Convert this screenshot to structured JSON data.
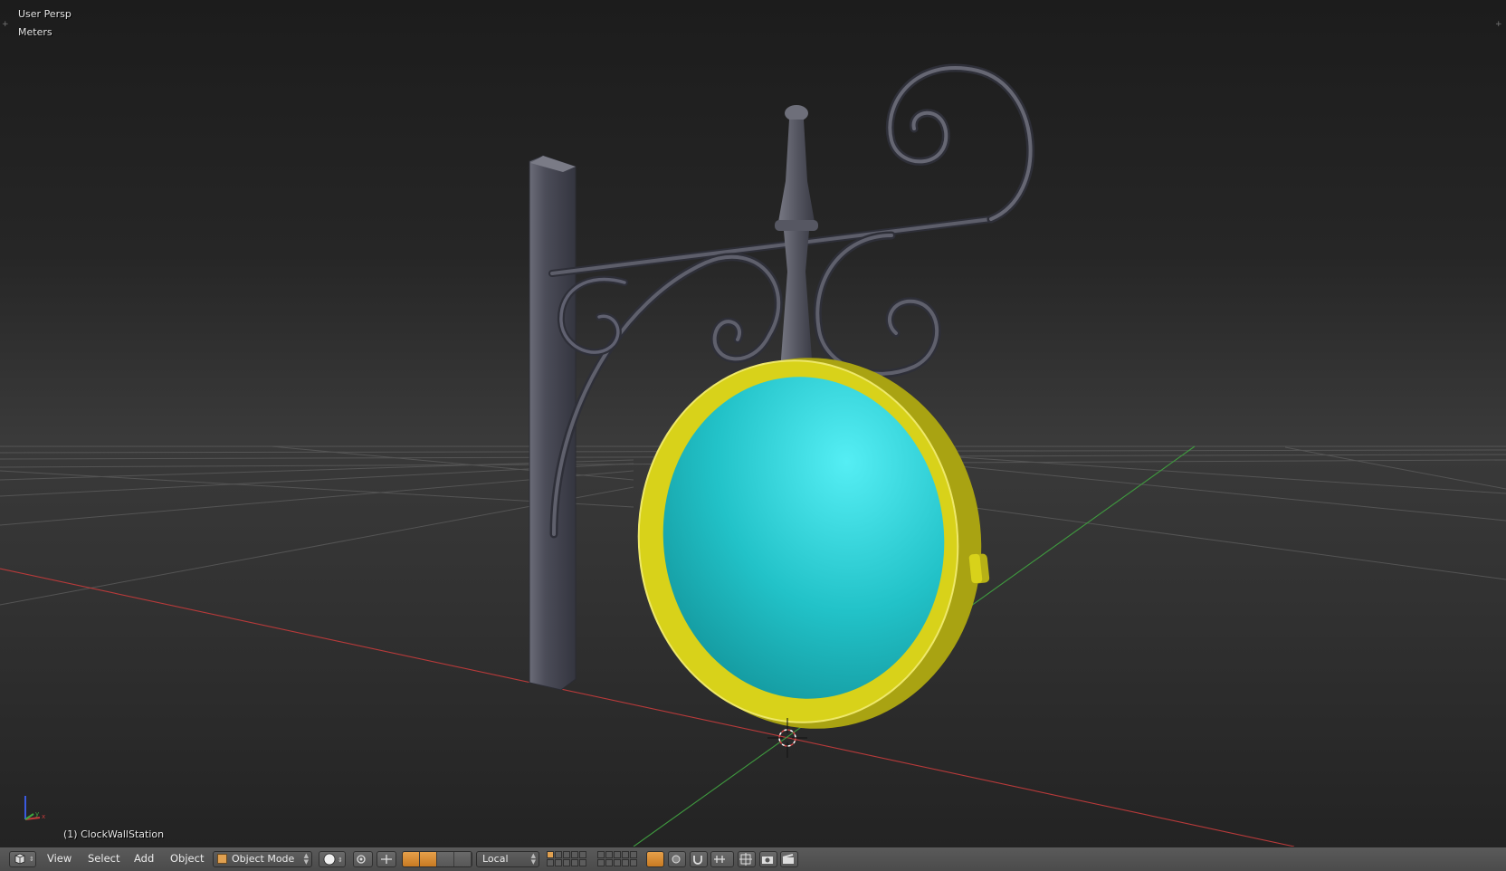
{
  "viewport": {
    "view_name": "User Persp",
    "units": "Meters",
    "active_object": "(1) ClockWallStation"
  },
  "header": {
    "menus": [
      "View",
      "Select",
      "Add",
      "Object"
    ],
    "mode": "Object Mode",
    "transform_orientation": "Local"
  },
  "colors": {
    "clock_rim": "#d8d21a",
    "clock_face": "#22c2c8",
    "iron": "#4a4b57",
    "x_axis": "#b83a3a",
    "y_axis": "#3f9a3f",
    "active_toggle": "#d88a30"
  },
  "icons": {
    "editor_type": "cube-view-icon",
    "mode": "object-cube-icon",
    "shading": "solid-sphere-icon",
    "pivot": "pivot-icon",
    "manipulator": "manipulator-icon",
    "snap": "magnet-icon",
    "render": "camera-icon"
  }
}
